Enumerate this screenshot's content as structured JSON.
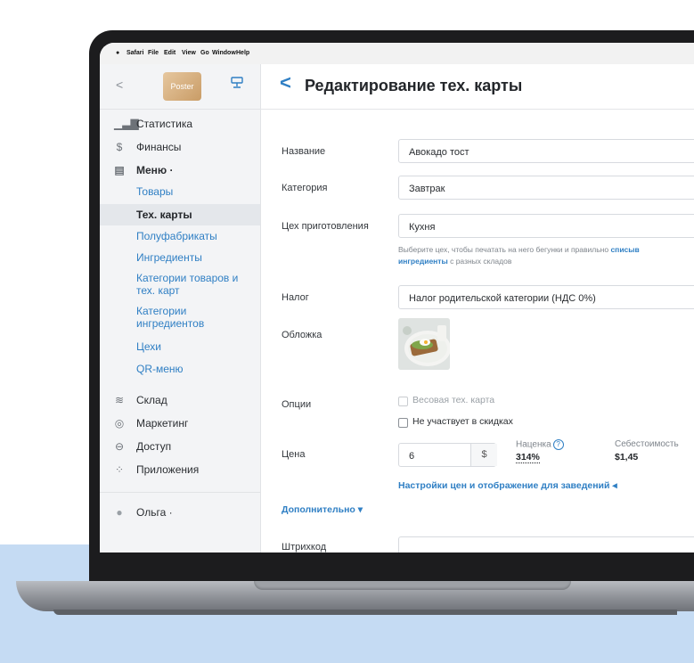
{
  "menubar": {
    "apple": "",
    "items": [
      "Safari",
      "File",
      "Edit",
      "View",
      "Go",
      "Window",
      "Help"
    ]
  },
  "sidebar": {
    "back_glyph": "<",
    "logo_text": "Poster",
    "nav": [
      {
        "label": "Статистика",
        "icon": "bar-chart-icon"
      },
      {
        "label": "Финансы",
        "icon": "dollar-icon"
      },
      {
        "label": "Меню ·",
        "icon": "document-icon"
      }
    ],
    "menu_sub": [
      "Товары",
      "Тех. карты",
      "Полуфабрикаты",
      "Ингредиенты",
      "Категории товаров и",
      "тех. карт",
      "Категории",
      "ингредиентов",
      "Цехи",
      "QR-меню"
    ],
    "active_sub": "Тех. карты",
    "nav2": [
      {
        "label": "Склад",
        "icon": "layers-icon"
      },
      {
        "label": "Маркетинг",
        "icon": "target-icon"
      },
      {
        "label": "Доступ",
        "icon": "lock-icon"
      },
      {
        "label": "Приложения",
        "icon": "grid-icon"
      }
    ],
    "user": "Ольга ·"
  },
  "header": {
    "back_glyph": "<",
    "title": "Редактирование тех. карты"
  },
  "form": {
    "name_label": "Название",
    "name_value": "Авокадо тост",
    "category_label": "Категория",
    "category_value": "Завтрак",
    "workshop_label": "Цех приготовления",
    "workshop_value": "Кухня",
    "hint_line1": "Выберите цех, чтобы печатать на него бегунки и правильно ",
    "hint_link1": "списыв",
    "hint_link2": "ингредиенты",
    "hint_line2": " с разных складов",
    "tax_label": "Налог",
    "tax_value": "Налог родительской категории (НДС 0%)",
    "cover_label": "Обложка",
    "options_label": "Опции",
    "opt_weight": "Весовая тех. карта",
    "opt_discount": "Не участвует в скидках",
    "price_label": "Цена",
    "price_value": "6",
    "currency": "$",
    "markup_label": "Наценка",
    "markup_value": "314%",
    "cost_label": "Себестоимость",
    "cost_value": "$1,45",
    "price_settings_link": "Настройки цен и отображение для заведений ◂",
    "additional_link": "Дополнительно ▾",
    "barcode_label": "Штрихкод",
    "barcode_value": ""
  },
  "colors": {
    "accent": "#2f7fc4",
    "background_band": "#c5dbf3"
  }
}
